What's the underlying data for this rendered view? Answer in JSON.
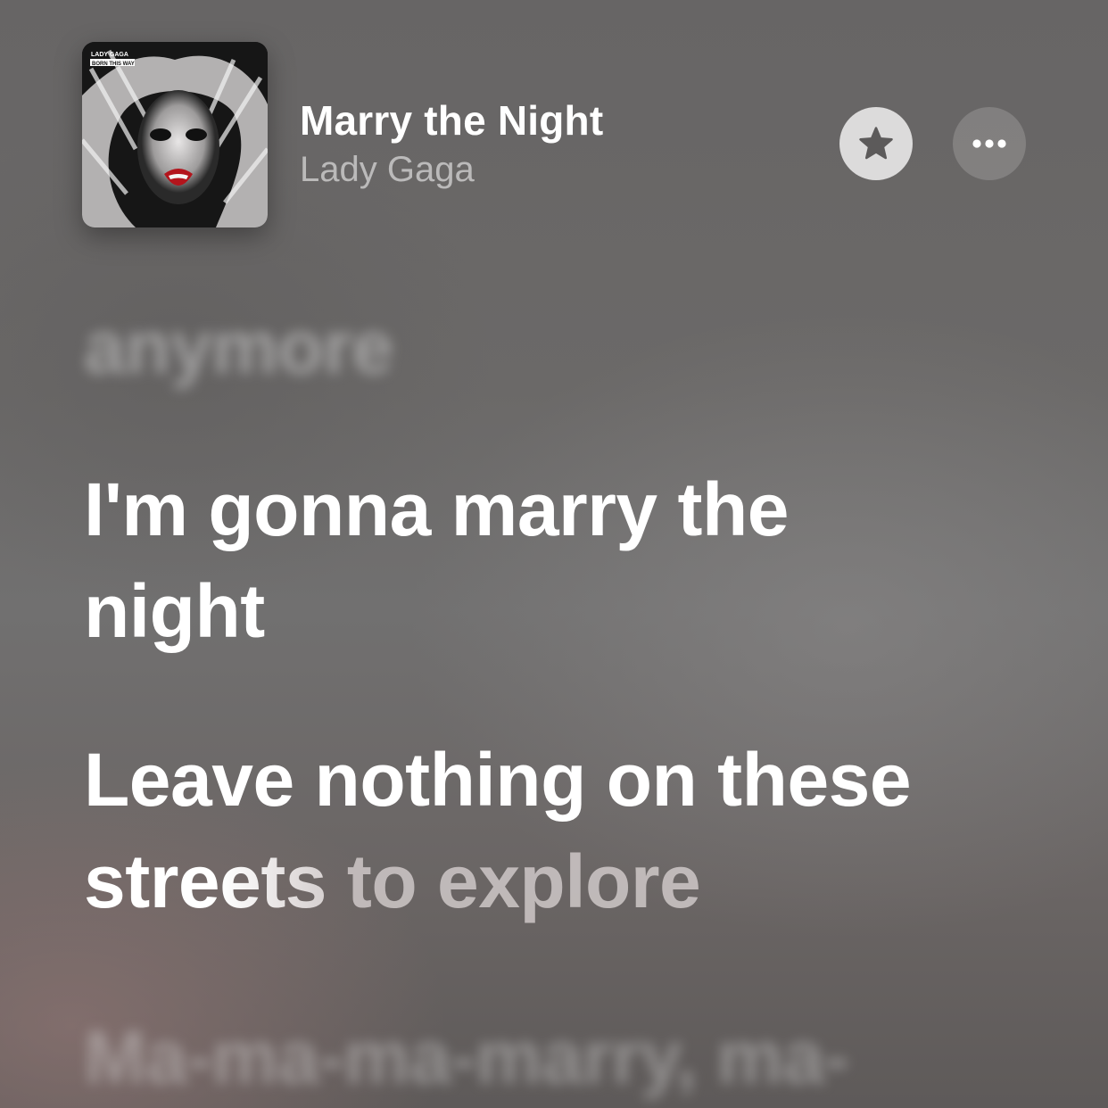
{
  "now_playing": {
    "title": "Marry the Night",
    "artist": "Lady Gaga",
    "album_art_text": "LADY GAGA BORN THIS WAY"
  },
  "controls": {
    "favorite_icon": "star-icon",
    "more_icon": "ellipsis-icon"
  },
  "lyrics": {
    "previous_line": "anymore",
    "current_line_1": "I'm gonna marry the",
    "current_line_2": "night",
    "active_line_1": "Leave nothing on these",
    "active_line_2_sung": "stre",
    "active_line_2_transition": "ets",
    "active_line_2_unsung": " to explore",
    "next_line": "Ma-ma-ma-marry, ma-"
  },
  "colors": {
    "background": "#6b6968",
    "text_primary": "#ffffff",
    "text_secondary": "rgba(255,255,255,0.55)",
    "favorite_button_bg": "#dcdbdb"
  }
}
